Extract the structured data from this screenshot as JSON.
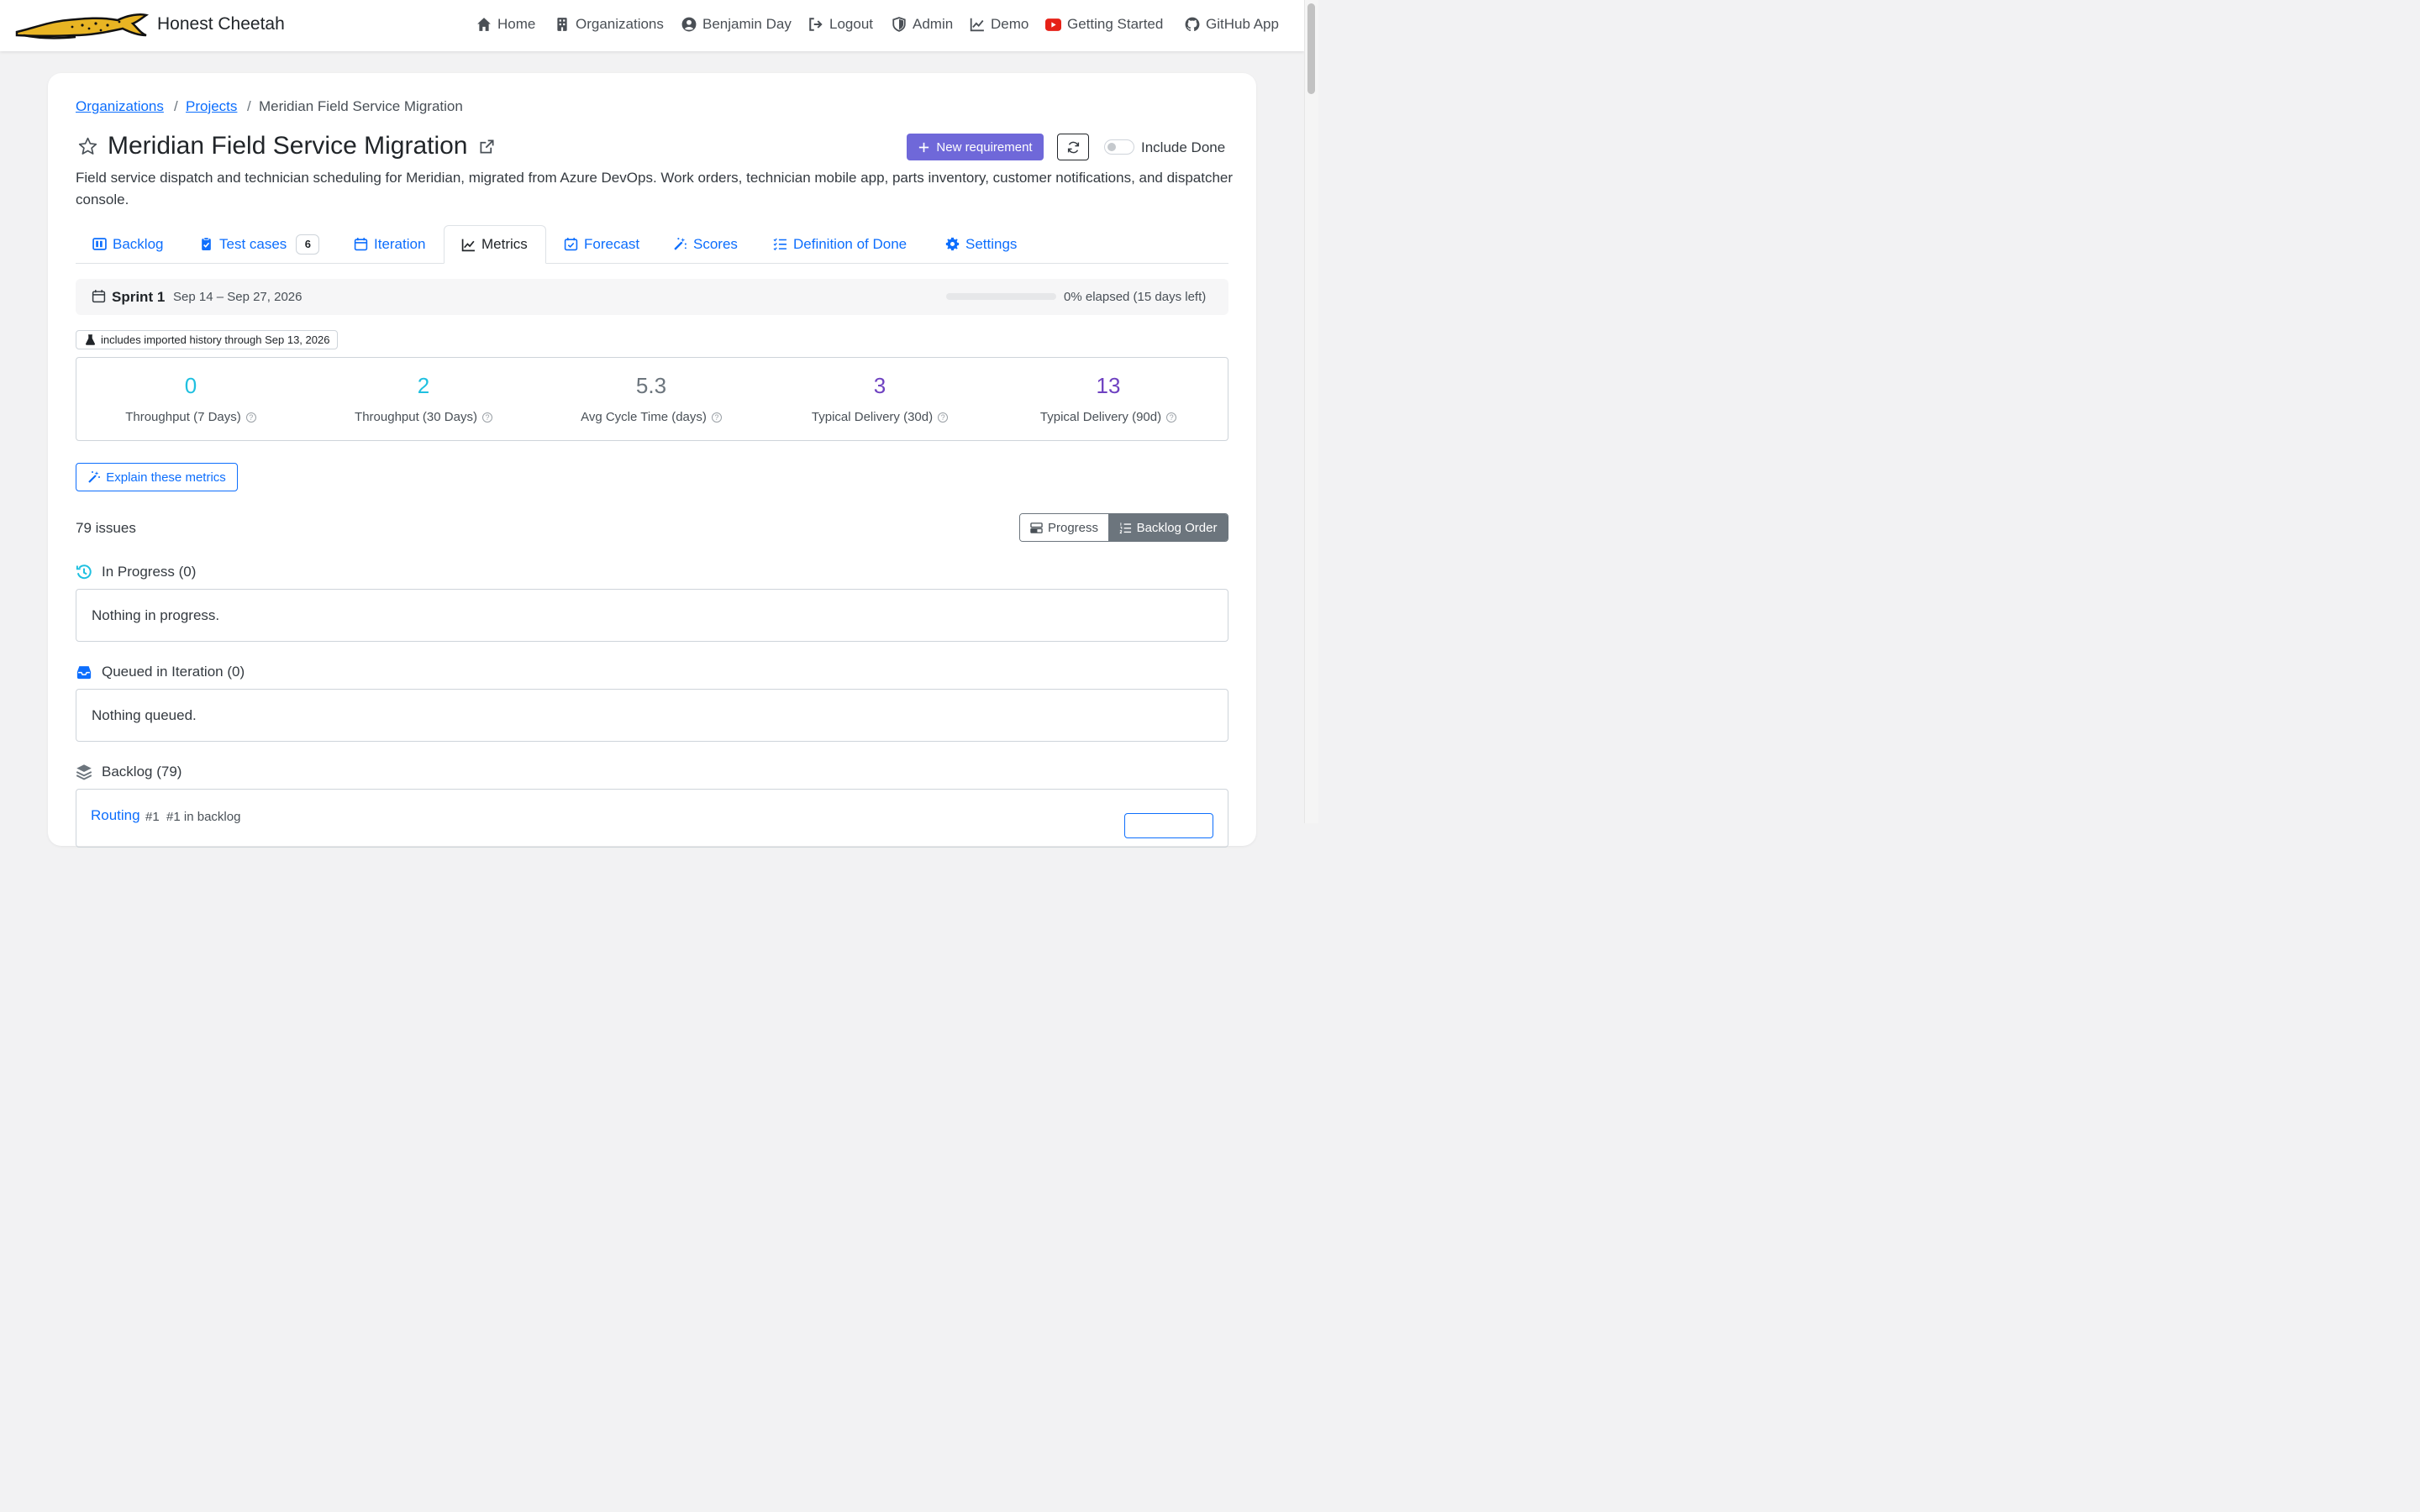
{
  "brand": {
    "name": "Honest Cheetah"
  },
  "nav": [
    {
      "label": "Home",
      "icon": "home-icon"
    },
    {
      "label": "Organizations",
      "icon": "building-icon"
    },
    {
      "label": "Benjamin Day",
      "icon": "user-circle-icon"
    },
    {
      "label": "Logout",
      "icon": "logout-icon"
    },
    {
      "label": "Admin",
      "icon": "shield-icon"
    },
    {
      "label": "Demo",
      "icon": "chart-line-icon"
    },
    {
      "label": "Getting Started",
      "icon": "youtube-icon"
    },
    {
      "label": "GitHub App",
      "icon": "github-icon"
    }
  ],
  "breadcrumb": {
    "organizations": "Organizations",
    "projects": "Projects",
    "current": "Meridian Field Service Migration"
  },
  "project": {
    "title": "Meridian Field Service Migration",
    "description": "Field service dispatch and technician scheduling for Meridian, migrated from Azure DevOps. Work orders, technician mobile app, parts inventory, customer notifications, and dispatcher console."
  },
  "actions": {
    "new_requirement": "New requirement",
    "include_done": "Include Done",
    "include_done_on": false
  },
  "tabs": [
    {
      "label": "Backlog"
    },
    {
      "label": "Test cases",
      "badge": "6"
    },
    {
      "label": "Iteration"
    },
    {
      "label": "Metrics",
      "active": true
    },
    {
      "label": "Forecast"
    },
    {
      "label": "Scores"
    },
    {
      "label": "Definition of Done"
    },
    {
      "label": "Settings"
    }
  ],
  "sprint": {
    "name": "Sprint 1",
    "dates": "Sep 14 – Sep 27, 2026",
    "elapsed_fraction": 0,
    "elapsed_text": "0% elapsed (15 days left)"
  },
  "history_chip": "includes imported history through Sep 13, 2026",
  "metrics": [
    {
      "value": "0",
      "label": "Throughput (7 Days)",
      "color": "#1fc0e0"
    },
    {
      "value": "2",
      "label": "Throughput (30 Days)",
      "color": "#1fc0e0"
    },
    {
      "value": "5.3",
      "label": "Avg Cycle Time (days)",
      "color": "#6c757d"
    },
    {
      "value": "3",
      "label": "Typical Delivery (30d)",
      "color": "#6f42c1"
    },
    {
      "value": "13",
      "label": "Typical Delivery (90d)",
      "color": "#6f42c1"
    }
  ],
  "explain_button": "Explain these metrics",
  "issues_count": "79 issues",
  "view_toggle": {
    "progress": "Progress",
    "backlog_order": "Backlog Order"
  },
  "sections": {
    "in_progress": {
      "title": "In Progress (0)",
      "empty": "Nothing in progress."
    },
    "queued": {
      "title": "Queued in Iteration (0)",
      "empty": "Nothing queued."
    },
    "backlog": {
      "title": "Backlog (79)"
    }
  },
  "backlog_items": [
    {
      "title": "Routing",
      "id": "#1",
      "position": "#1 in backlog"
    }
  ]
}
